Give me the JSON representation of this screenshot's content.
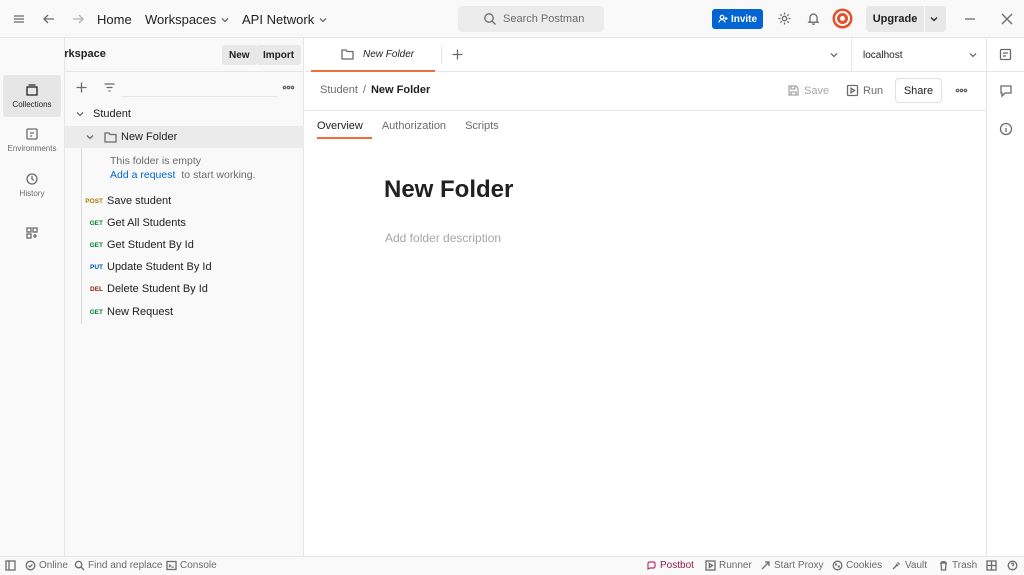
{
  "topbar": {
    "home": "Home",
    "workspaces": "Workspaces",
    "api_network": "API Network",
    "search_placeholder": "Search Postman",
    "invite": "Invite",
    "upgrade": "Upgrade"
  },
  "workspace": {
    "name": "My Workspace",
    "new_label": "New",
    "import_label": "Import"
  },
  "rail": {
    "items": [
      {
        "label": "Collections",
        "icon": "collections-icon"
      },
      {
        "label": "Environments",
        "icon": "environments-icon"
      },
      {
        "label": "History",
        "icon": "history-icon"
      },
      {
        "label": "",
        "icon": "apps-icon"
      }
    ]
  },
  "sidebar": {
    "collection": "Student",
    "folder": "New Folder",
    "empty_text": "This folder is empty",
    "add_request_link": "Add a request",
    "add_request_suffix": "to start working.",
    "requests": [
      {
        "method": "POST",
        "name": "Save student",
        "color": "#ad7a03"
      },
      {
        "method": "GET",
        "name": "Get All Students",
        "color": "#007f31"
      },
      {
        "method": "GET",
        "name": "Get Student By Id",
        "color": "#007f31"
      },
      {
        "method": "PUT",
        "name": "Update Student By Id",
        "color": "#0053b8"
      },
      {
        "method": "DEL",
        "name": "Delete Student By Id",
        "color": "#8e1a10"
      },
      {
        "method": "GET",
        "name": "New Request",
        "color": "#007f31"
      }
    ]
  },
  "tabs": {
    "active_tab": "New Folder",
    "environment": "localhost"
  },
  "main": {
    "breadcrumb_parent": "Student",
    "breadcrumb_sep": "/",
    "breadcrumb_current": "New Folder",
    "save": "Save",
    "run": "Run",
    "share": "Share",
    "subtabs": [
      "Overview",
      "Authorization",
      "Scripts"
    ],
    "title": "New Folder",
    "description_placeholder": "Add folder description"
  },
  "statusbar": {
    "online": "Online",
    "find_replace": "Find and replace",
    "console": "Console",
    "postbot": "Postbot",
    "runner": "Runner",
    "start_proxy": "Start Proxy",
    "cookies": "Cookies",
    "vault": "Vault",
    "trash": "Trash"
  },
  "colors": {
    "accent": "#f26b3a",
    "primary_blue": "#0265d2",
    "avatar": "#e5502f"
  }
}
